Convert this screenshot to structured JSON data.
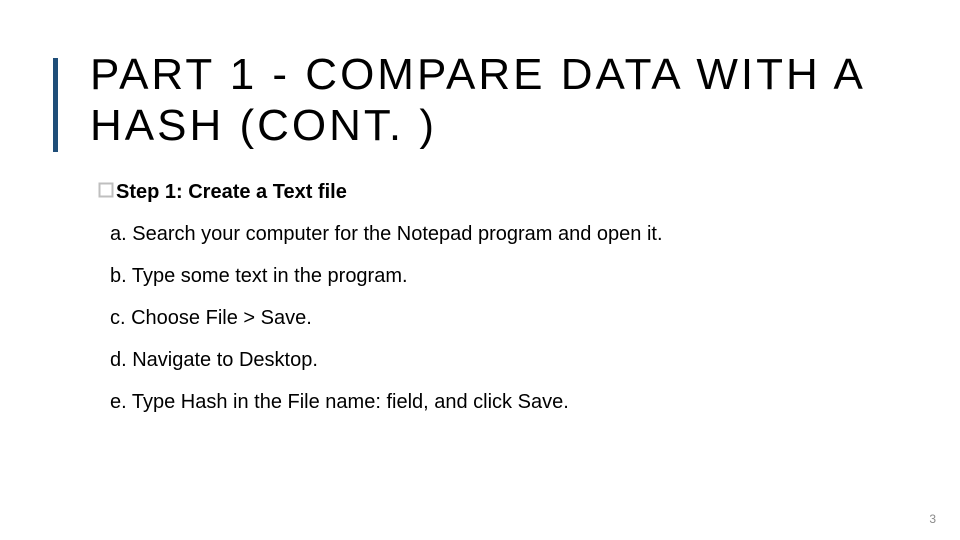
{
  "title": "PART 1 - COMPARE DATA WITH A HASH (CONT. )",
  "step": {
    "label": "Step 1: Create a Text file",
    "bullet_icon": "hollow-square-icon"
  },
  "items": [
    "a. Search your computer for the Notepad program and open it.",
    "b. Type some text in the program.",
    "c. Choose File > Save.",
    "d. Navigate to Desktop.",
    "e. Type Hash in the File name: field, and click Save."
  ],
  "page_number": "3",
  "colors": {
    "accent": "#1f4e79",
    "bullet": "#bfbfbf"
  }
}
